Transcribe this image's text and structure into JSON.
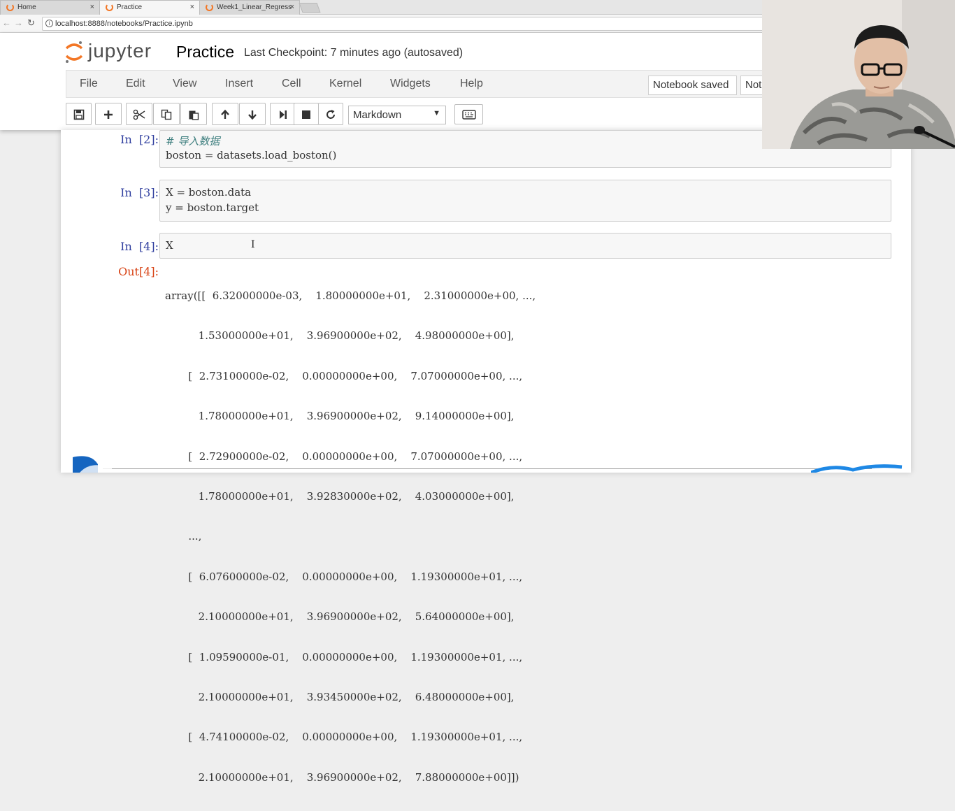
{
  "browser": {
    "tabs": [
      {
        "label": "Home",
        "close": "×"
      },
      {
        "label": "Practice",
        "close": "×"
      },
      {
        "label": "Week1_Linear_Regress",
        "close": "×"
      }
    ],
    "url": "localhost:8888/notebooks/Practice.ipynb"
  },
  "jupyter": {
    "logo_text": "jupyter",
    "notebook_name": "Practice",
    "checkpoint": "Last Checkpoint: 7 minutes ago (autosaved)",
    "menu": [
      "File",
      "Edit",
      "View",
      "Insert",
      "Cell",
      "Kernel",
      "Widgets",
      "Help"
    ],
    "notebook_saved": "Notebook saved",
    "trusted_partial": "Not",
    "cell_type": "Markdown"
  },
  "cells": [
    {
      "prompt": "In  [2]:",
      "lines": [
        {
          "text": "# 导入数据",
          "comment": true
        },
        {
          "text": "boston = datasets.load_boston()"
        }
      ]
    },
    {
      "prompt": "In  [3]:",
      "lines": [
        {
          "text": "X = boston.data"
        },
        {
          "text": "y = boston.target"
        }
      ]
    },
    {
      "prompt": "In  [4]:",
      "lines": [
        {
          "text": "X"
        }
      ]
    }
  ],
  "output": {
    "prompt": "Out[4]:",
    "lines": [
      "array([[  6.32000000e-03,    1.80000000e+01,    2.31000000e+00, ...,",
      "          1.53000000e+01,    3.96900000e+02,    4.98000000e+00],",
      "       [  2.73100000e-02,    0.00000000e+00,    7.07000000e+00, ...,",
      "          1.78000000e+01,    3.96900000e+02,    9.14000000e+00],",
      "       [  2.72900000e-02,    0.00000000e+00,    7.07000000e+00, ...,",
      "          1.78000000e+01,    3.92830000e+02,    4.03000000e+00],",
      "       ...,",
      "       [  6.07600000e-02,    0.00000000e+00,    1.19300000e+01, ...,",
      "          2.10000000e+01,    3.96900000e+02,    5.64000000e+00],",
      "       [  1.09590000e-01,    0.00000000e+00,    1.19300000e+01, ...,",
      "          2.10000000e+01,    3.93450000e+02,    6.48000000e+00],",
      "       [  4.74100000e-02,    0.00000000e+00,    1.19300000e+01, ...,",
      "          2.10000000e+01,    3.96900000e+02,    7.88000000e+00]])"
    ]
  },
  "colors": {
    "prompt_in": "#303f9f",
    "prompt_out": "#d84315",
    "jupyter_orange": "#f37726"
  }
}
